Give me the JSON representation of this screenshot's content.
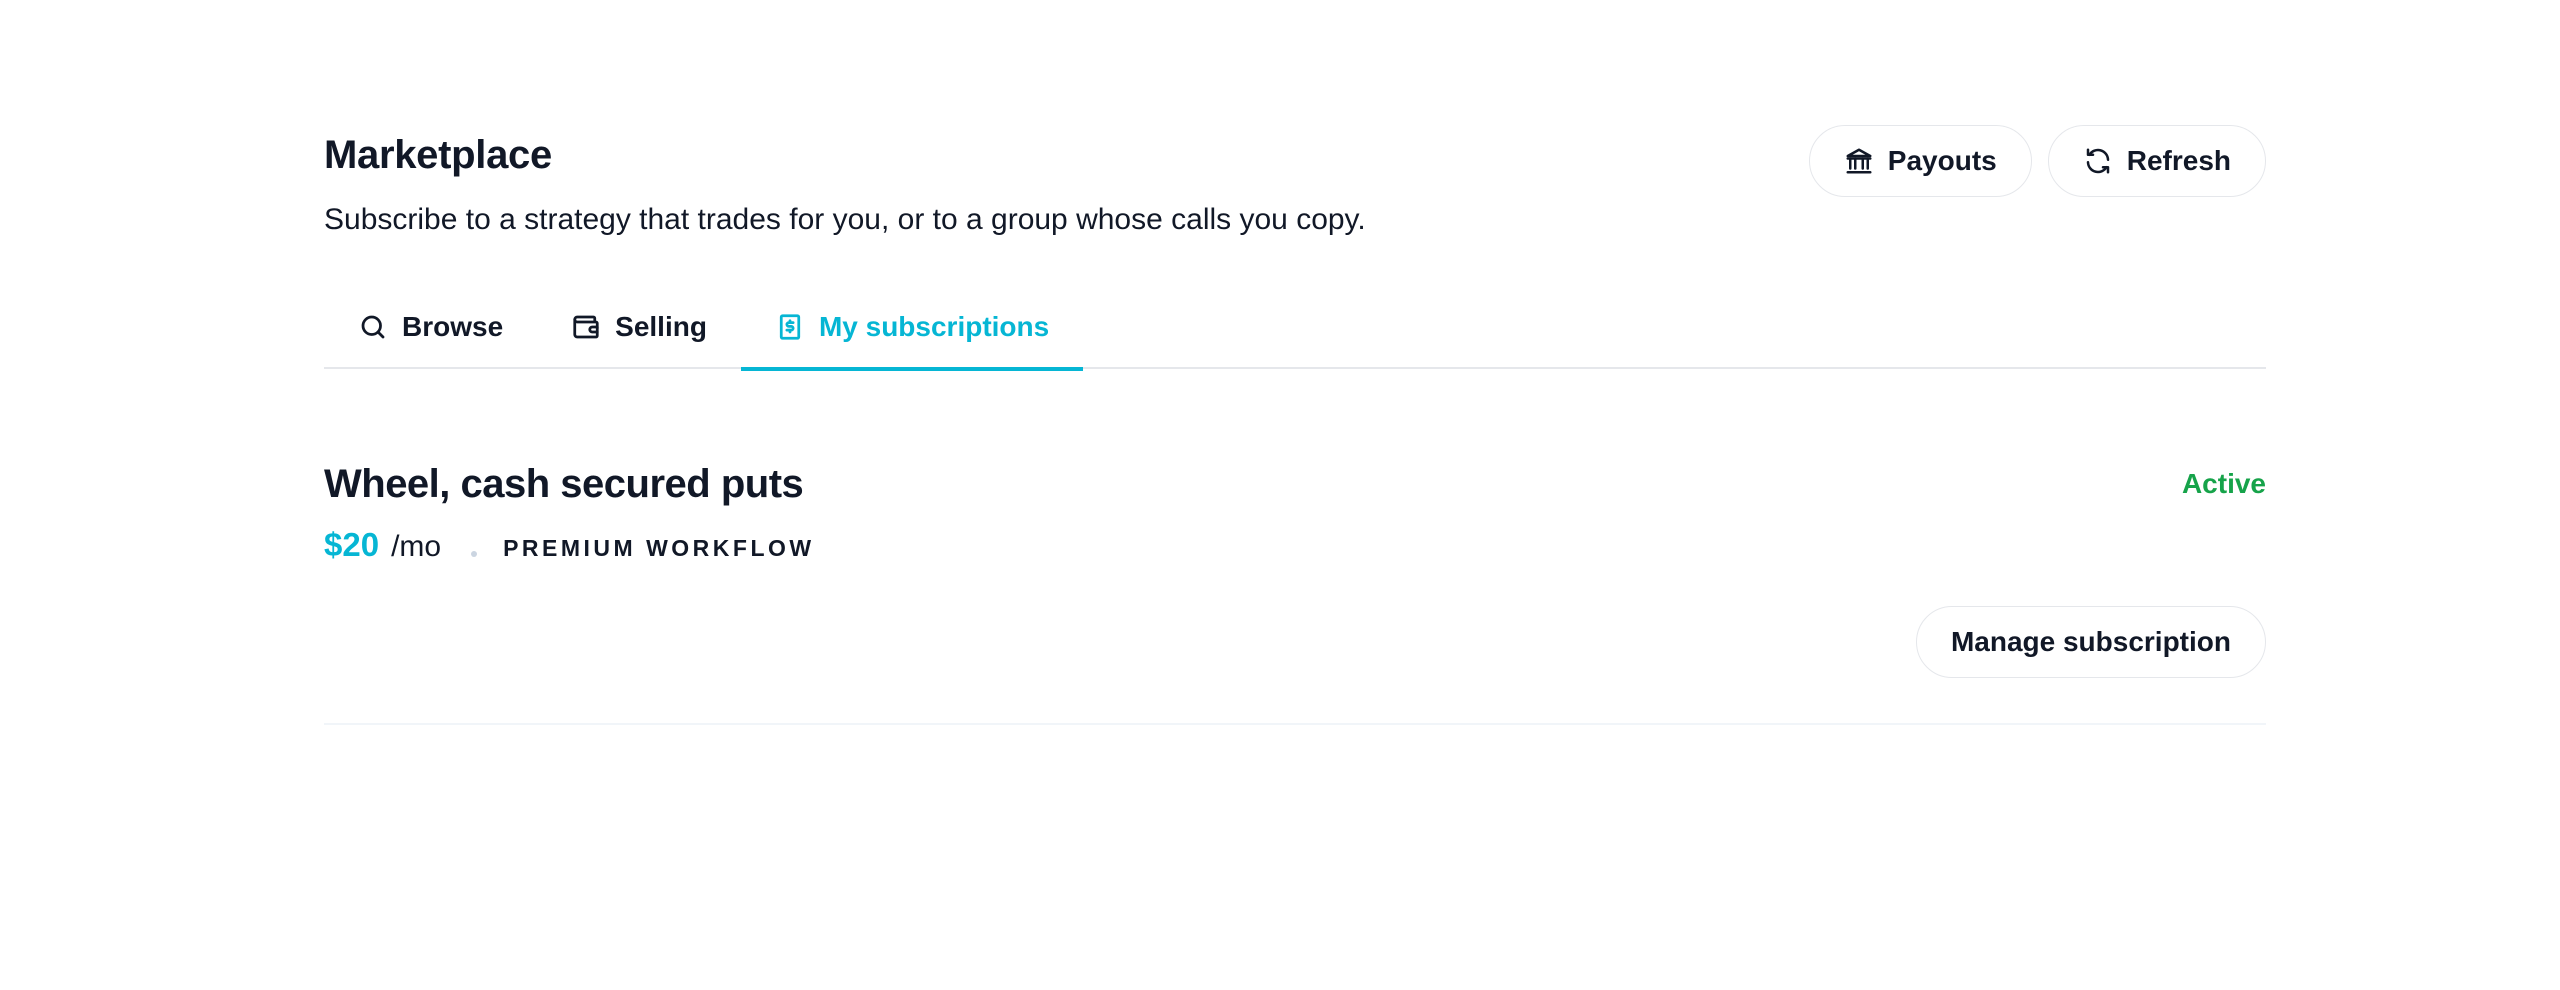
{
  "header": {
    "title": "Marketplace",
    "subtitle": "Subscribe to a strategy that trades for you, or to a group whose calls you copy.",
    "actions": [
      {
        "label": "Payouts",
        "icon": "bank-icon"
      },
      {
        "label": "Refresh",
        "icon": "refresh-icon"
      }
    ]
  },
  "tabs": [
    {
      "label": "Browse",
      "icon": "search-icon",
      "active": false
    },
    {
      "label": "Selling",
      "icon": "wallet-icon",
      "active": false
    },
    {
      "label": "My subscriptions",
      "icon": "receipt-dollar-icon",
      "active": true
    }
  ],
  "subscription": {
    "title": "Wheel, cash secured puts",
    "status": "Active",
    "price": "$20",
    "period": "/mo",
    "tag": "PREMIUM WORKFLOW",
    "manage_label": "Manage subscription"
  },
  "colors": {
    "accent": "#06b6d4",
    "status_active": "#16a34a",
    "text": "#111827",
    "border": "#e5e7eb"
  }
}
